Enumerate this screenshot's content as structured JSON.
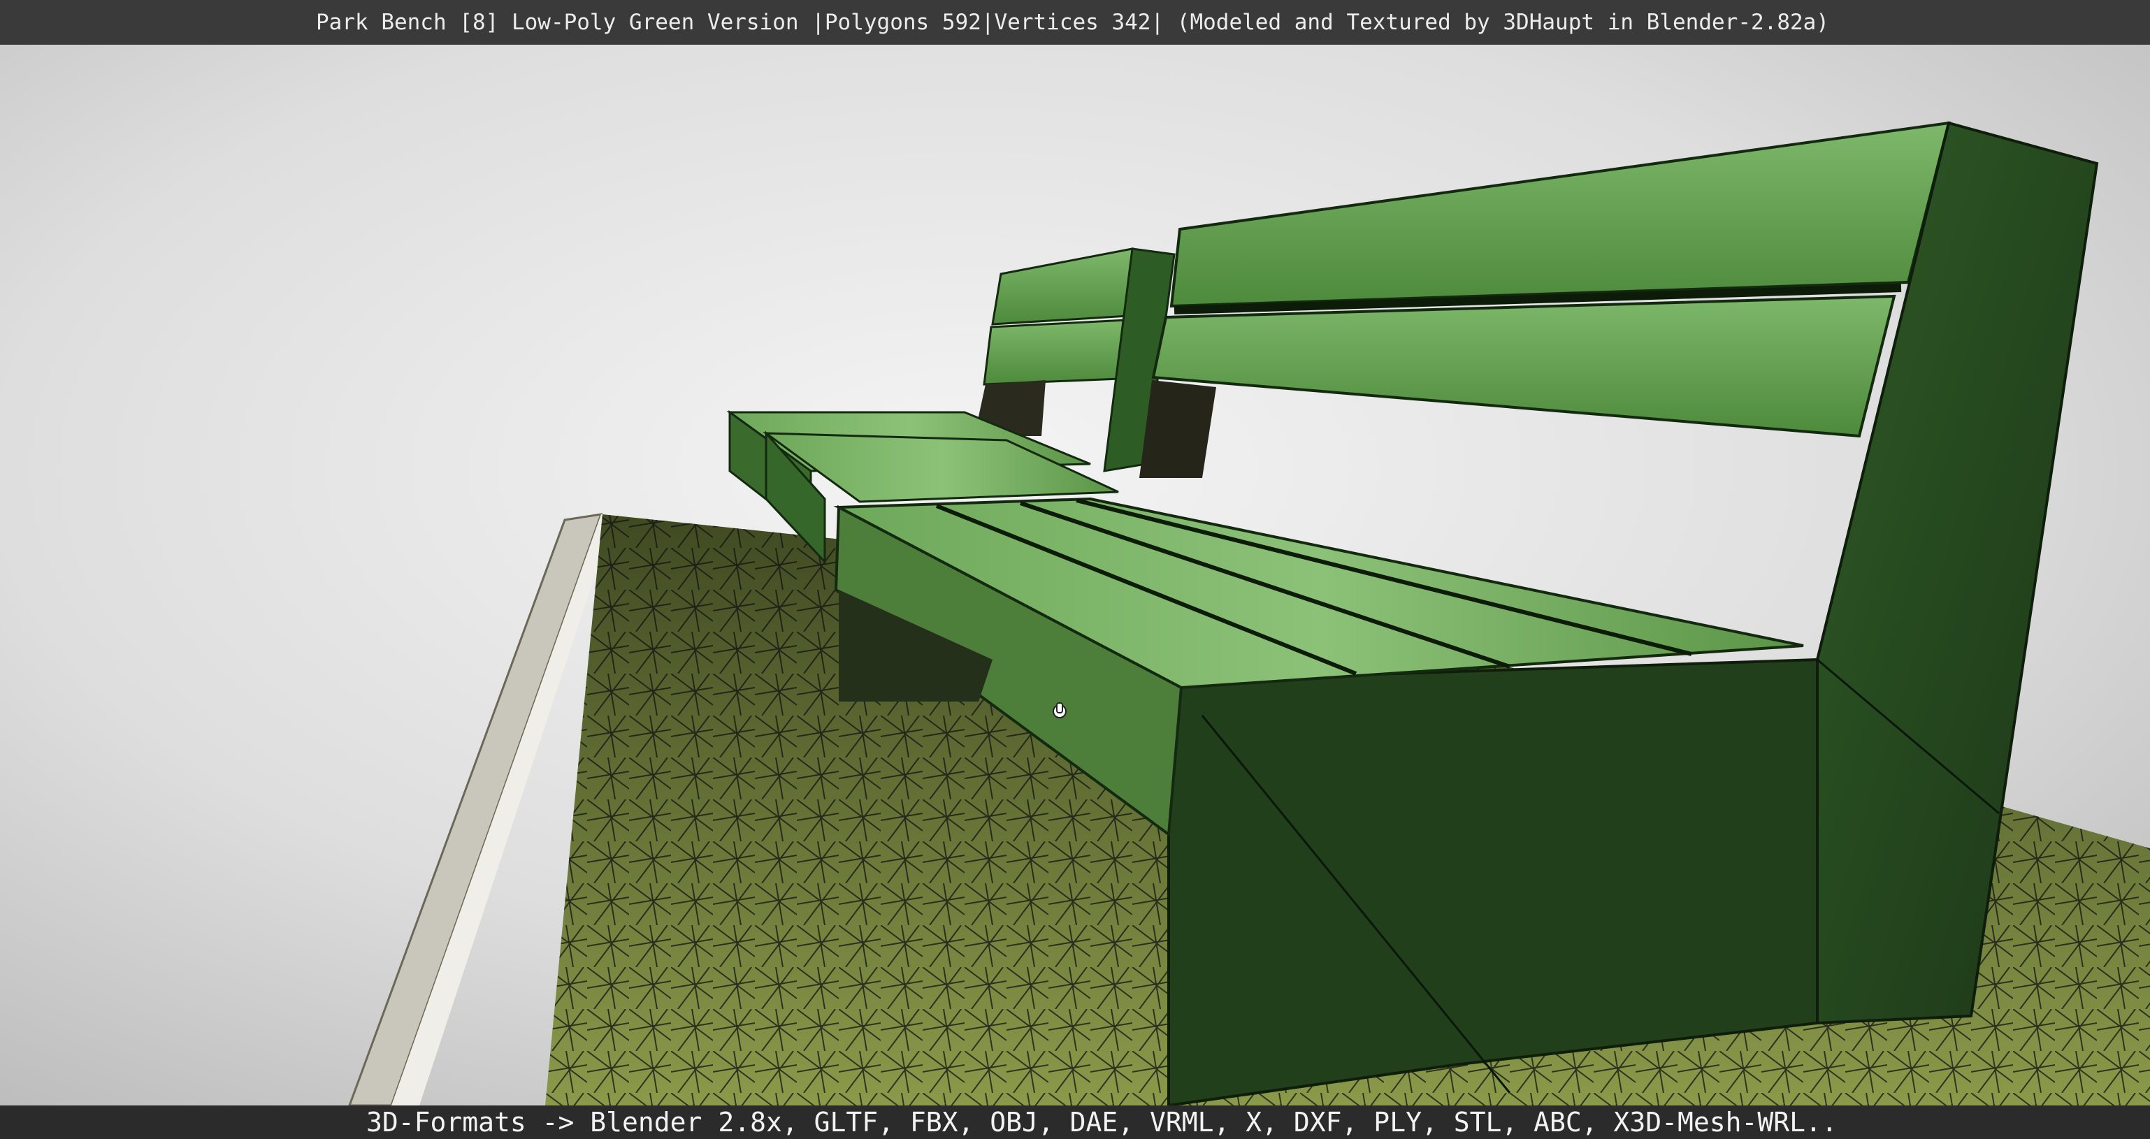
{
  "window": {
    "title": "Park Bench [8] Low-Poly Green Version |Polygons 592|Vertices 342| (Modeled and Textured by 3DHaupt in Blender-2.82a)"
  },
  "footer": {
    "formats": "3D-Formats -> Blender 2.8x, GLTF, FBX, OBJ, DAE, VRML, X, DXF, PLY, STL, ABC, X3D-Mesh-WRL.."
  },
  "scene": {
    "subject": "park bench",
    "cursor": "hand-cursor-icon"
  },
  "colors": {
    "title_bar": "#3a3a3a",
    "footer_bar": "#2b2b2b",
    "bench_green": "#3d7a32",
    "bench_dark": "#1f3d1a",
    "grass": "#6f7f3a",
    "background": "#d9d9d9"
  }
}
